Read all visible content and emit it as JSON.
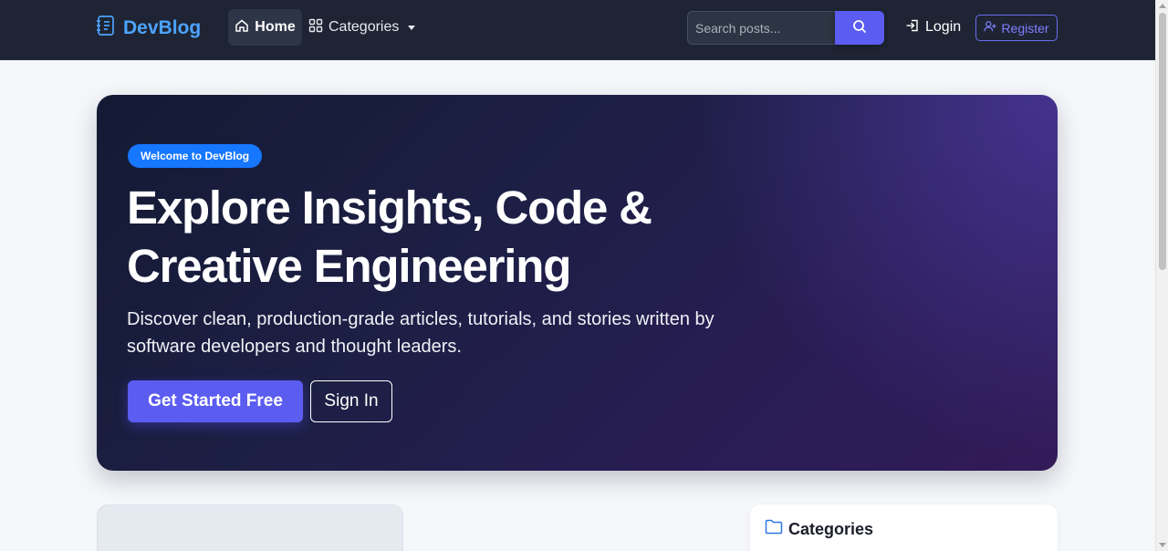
{
  "nav": {
    "brand": "DevBlog",
    "home": "Home",
    "categories": "Categories",
    "search_placeholder": "Search posts...",
    "login": "Login",
    "register": "Register"
  },
  "hero": {
    "badge": "Welcome to DevBlog",
    "title_line1": "Explore Insights, Code &",
    "title_line2": "Creative Engineering",
    "subtitle_line1": "Discover clean, production-grade articles, tutorials, and stories written by",
    "subtitle_line2": "software developers and thought leaders.",
    "cta_primary": "Get Started Free",
    "cta_secondary": "Sign In"
  },
  "sidebar": {
    "categories_title": "Categories"
  },
  "colors": {
    "accent": "#5b5cf0",
    "brand": "#4da3ff",
    "badge": "#1677ff",
    "navbar_bg": "#1e2433"
  },
  "icons": {
    "brand": "journal-icon",
    "home": "house-icon",
    "categories": "grid-icon",
    "search": "search-icon",
    "login": "login-arrow-icon",
    "register": "user-plus-icon",
    "folder": "folder-icon"
  }
}
